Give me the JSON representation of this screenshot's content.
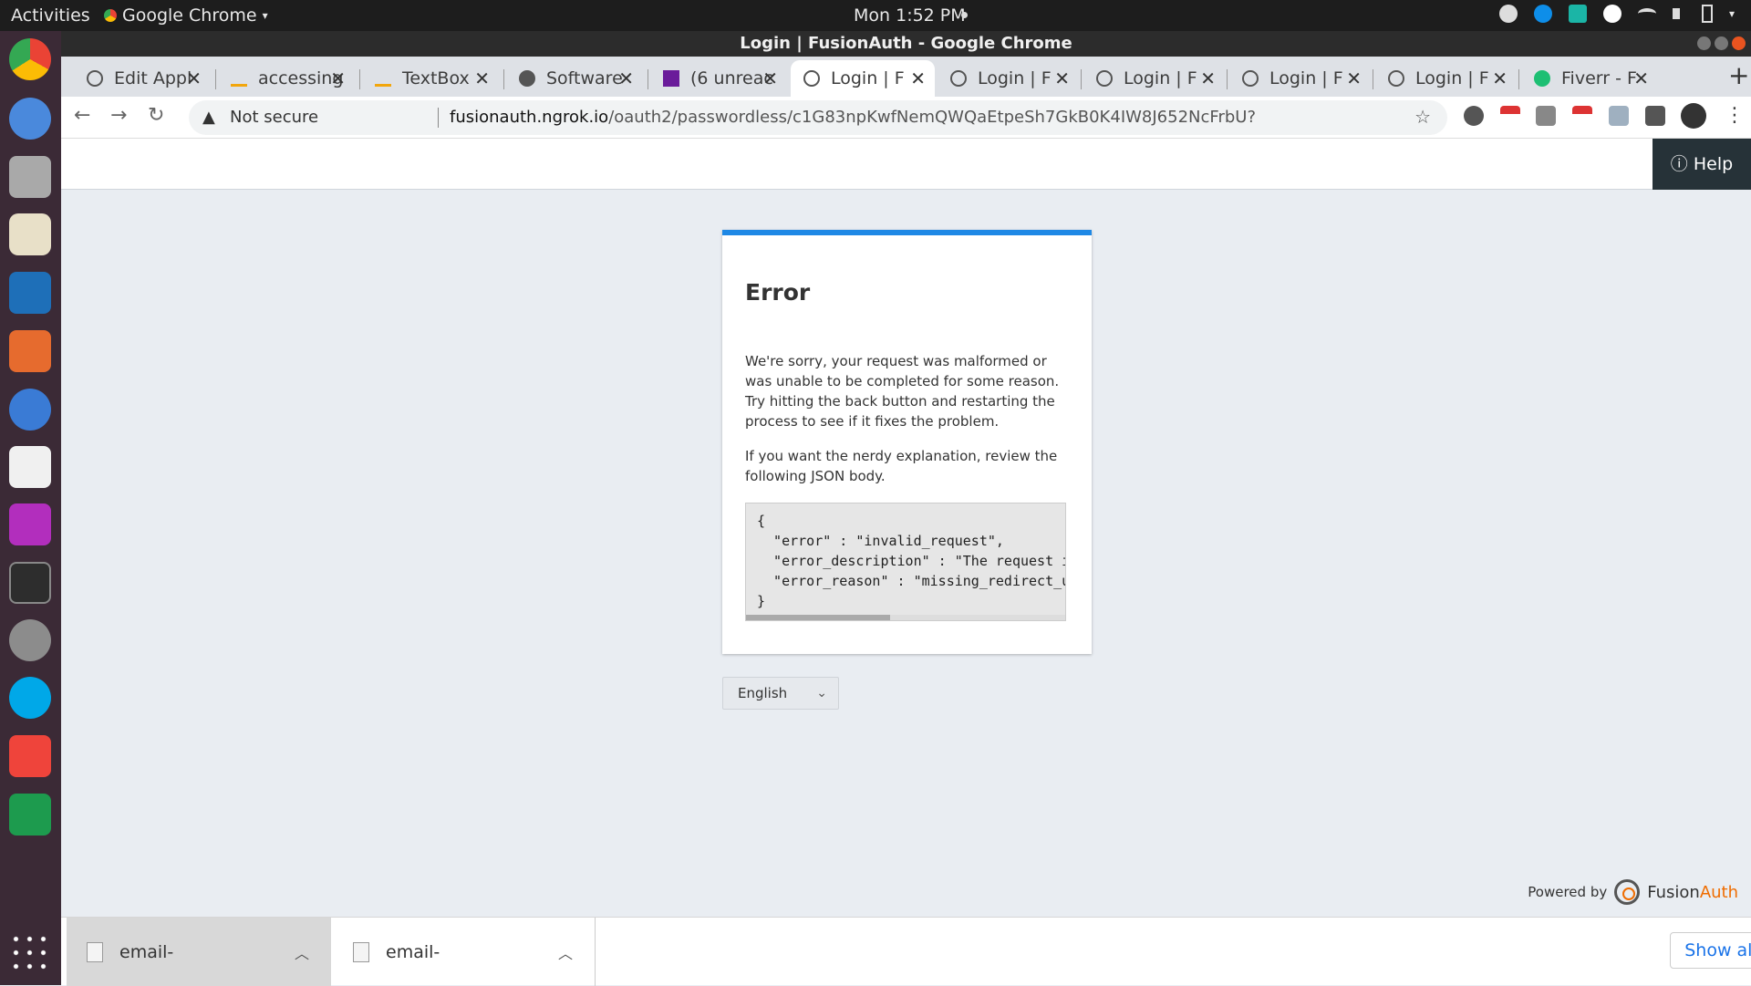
{
  "system": {
    "activities": "Activities",
    "app_name": "Google Chrome",
    "clock": "Mon  1:52 PM"
  },
  "window": {
    "title": "Login | FusionAuth - Google Chrome"
  },
  "tabs": [
    {
      "label": "Edit Appl"
    },
    {
      "label": "accessing"
    },
    {
      "label": "TextBox"
    },
    {
      "label": "Software"
    },
    {
      "label": "(6 unreac"
    },
    {
      "label": "Login | F"
    },
    {
      "label": "Login | F"
    },
    {
      "label": "Login | F"
    },
    {
      "label": "Login | F"
    },
    {
      "label": "Login | F"
    },
    {
      "label": "Fiverr - F"
    }
  ],
  "address": {
    "warning": "Not secure",
    "host": "fusionauth.ngrok.io",
    "path": "/oauth2/passwordless/c1G83npKwfNemQWQaEtpeSh7GkB0K4IW8J652NcFrbU?"
  },
  "page": {
    "help_label": "Help",
    "error_title": "Error",
    "message": "We're sorry, your request was malformed or was unable to be completed for some reason. Try hitting the back button and restarting the process to see if it fixes the problem.",
    "nerdy": "If you want the nerdy explanation, review the following JSON body.",
    "json_body": "{\n  \"error\" : \"invalid_request\",\n  \"error_description\" : \"The request i\n  \"error_reason\" : \"missing_redirect_u\n}",
    "language": "English",
    "powered_by": "Powered by",
    "brand_a": "Fusion",
    "brand_b": "Auth"
  },
  "downloads": {
    "items": [
      {
        "name": "email-"
      },
      {
        "name": "email-"
      }
    ],
    "show_all": "Show all"
  }
}
